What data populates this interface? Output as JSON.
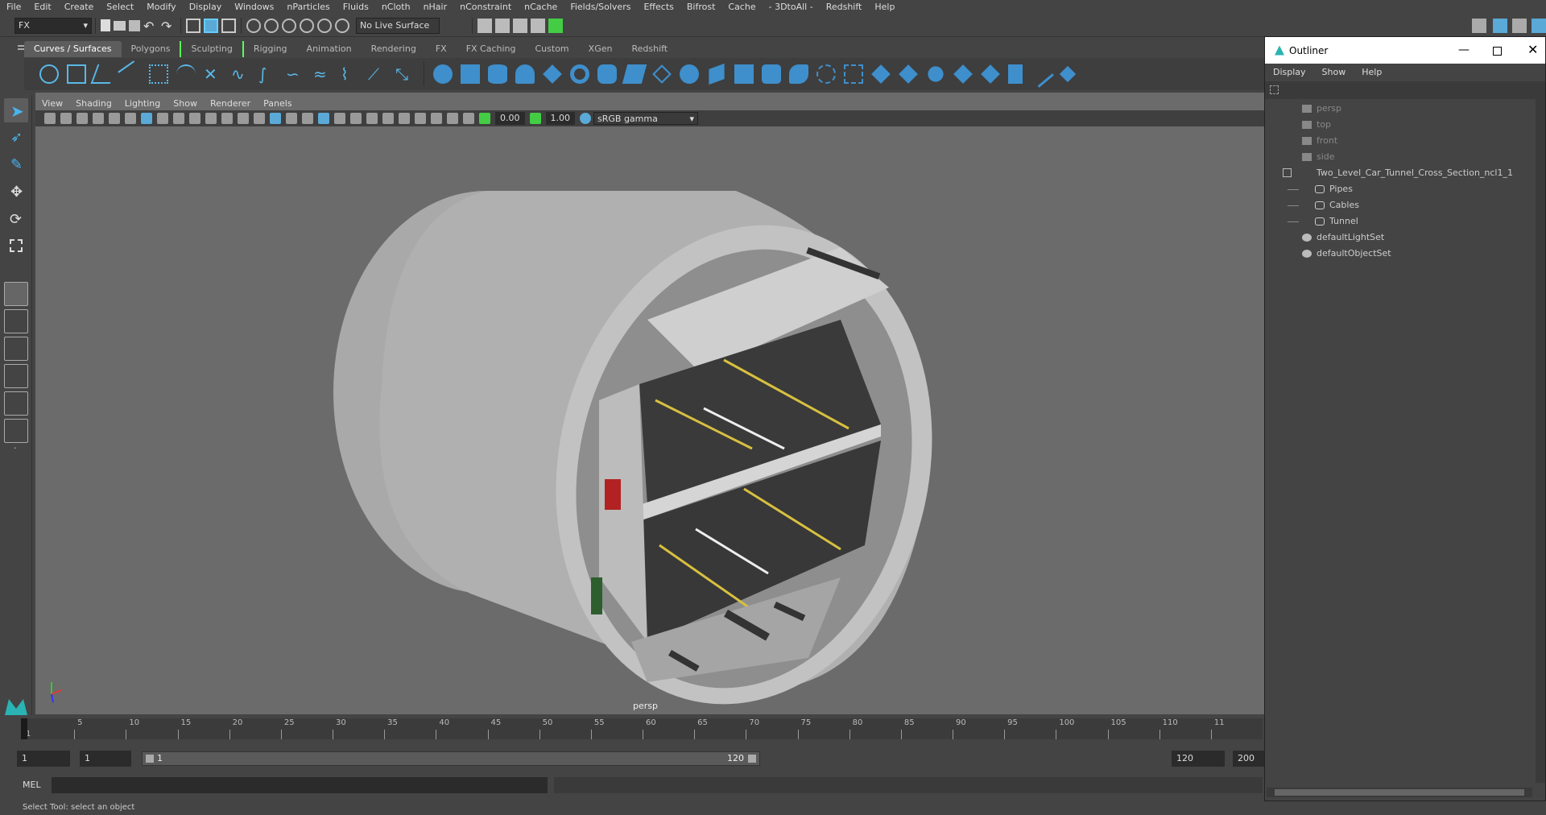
{
  "menubar": [
    "File",
    "Edit",
    "Create",
    "Select",
    "Modify",
    "Display",
    "Windows",
    "nParticles",
    "Fluids",
    "nCloth",
    "nHair",
    "nConstraint",
    "nCache",
    "Fields/Solvers",
    "Effects",
    "Bifrost",
    "Cache",
    "- 3DtoAll -",
    "Redshift",
    "Help"
  ],
  "statusline": {
    "menu_set": "FX",
    "live_surface": "No Live Surface"
  },
  "shelf_tabs": [
    "Curves / Surfaces",
    "Polygons",
    "Sculpting",
    "Rigging",
    "Animation",
    "Rendering",
    "FX",
    "FX Caching",
    "Custom",
    "XGen",
    "Redshift"
  ],
  "panel_menu": [
    "View",
    "Shading",
    "Lighting",
    "Show",
    "Renderer",
    "Panels"
  ],
  "panel_tools": {
    "exposure": "0.00",
    "gamma": "1.00",
    "color_space": "sRGB gamma"
  },
  "viewport": {
    "camera_label": "persp"
  },
  "timeline": {
    "ticks": [
      "1",
      "5",
      "10",
      "15",
      "20",
      "25",
      "30",
      "35",
      "40",
      "45",
      "50",
      "55",
      "60",
      "65",
      "70",
      "75",
      "80",
      "85",
      "90",
      "95",
      "100",
      "105",
      "110",
      "11"
    ]
  },
  "range": {
    "start": "1",
    "current": "1",
    "slider_start": "1",
    "slider_end": "120",
    "end": "120",
    "max": "200"
  },
  "command": {
    "lang": "MEL"
  },
  "help_line": "Select Tool: select an object",
  "outliner": {
    "title": "Outliner",
    "menu": [
      "Display",
      "Show",
      "Help"
    ],
    "items": [
      {
        "label": "persp",
        "level": 0,
        "type": "camera",
        "dim": true
      },
      {
        "label": "top",
        "level": 0,
        "type": "camera",
        "dim": true
      },
      {
        "label": "front",
        "level": 0,
        "type": "camera",
        "dim": true
      },
      {
        "label": "side",
        "level": 0,
        "type": "camera",
        "dim": true
      },
      {
        "label": "Two_Level_Car_Tunnel_Cross_Section_ncl1_1",
        "level": 0,
        "type": "group",
        "dim": false
      },
      {
        "label": "Pipes",
        "level": 1,
        "type": "mesh",
        "dim": false
      },
      {
        "label": "Cables",
        "level": 1,
        "type": "mesh",
        "dim": false
      },
      {
        "label": "Tunnel",
        "level": 1,
        "type": "mesh",
        "dim": false
      },
      {
        "label": "defaultLightSet",
        "level": 0,
        "type": "set",
        "dim": false
      },
      {
        "label": "defaultObjectSet",
        "level": 0,
        "type": "set",
        "dim": false
      }
    ]
  }
}
